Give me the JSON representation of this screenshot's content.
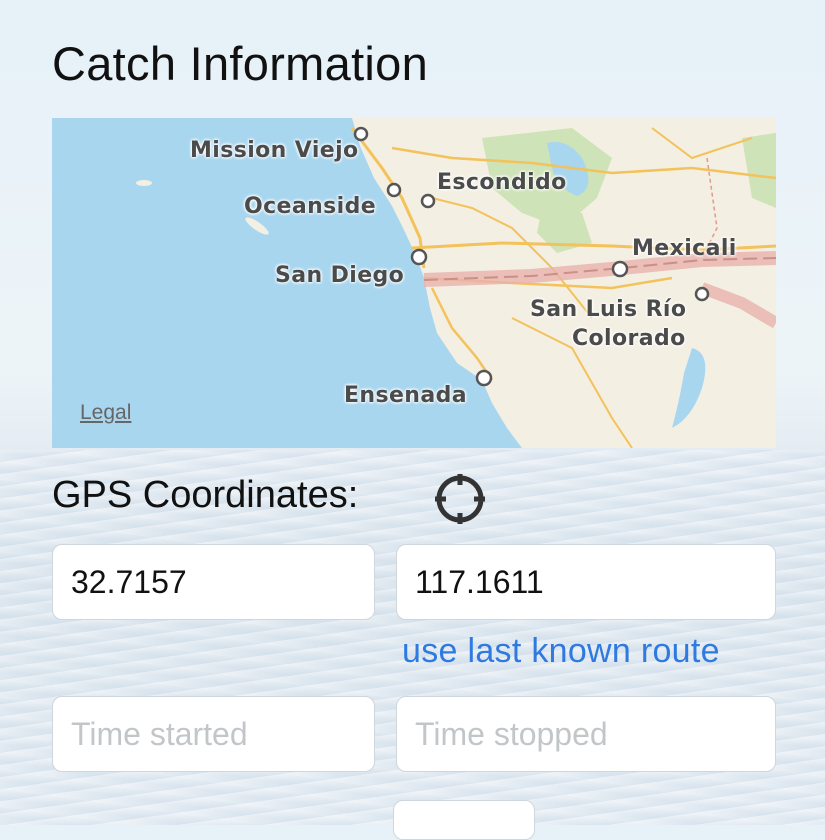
{
  "page": {
    "title": "Catch Information"
  },
  "map": {
    "labels": {
      "mission_viejo": "Mission Viejo",
      "oceanside": "Oceanside",
      "escondido": "Escondido",
      "san_diego": "San Diego",
      "mexicali": "Mexicali",
      "san_luis_line1": "San Luis Río",
      "san_luis_line2": "Colorado",
      "ensenada": "Ensenada"
    },
    "legal": "Legal",
    "colors": {
      "water": "#a9d6ef",
      "land": "#f4efe3",
      "park": "#cfe3b8",
      "road": "#f3c25a",
      "border": "#e8b2ac"
    }
  },
  "gps": {
    "label": "GPS Coordinates:",
    "locate_icon": "crosshair-icon",
    "latitude": "32.7157",
    "longitude": "117.1611",
    "use_last_route": "use last known route"
  },
  "time": {
    "started_placeholder": "Time started",
    "stopped_placeholder": "Time stopped"
  }
}
